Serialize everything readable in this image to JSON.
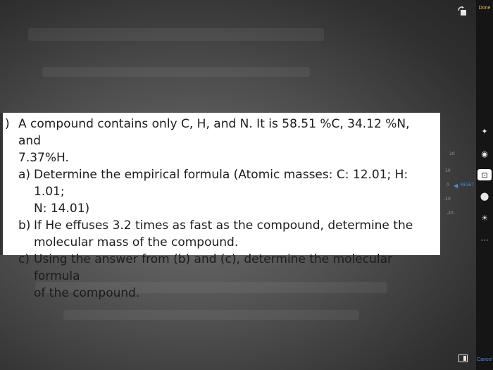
{
  "editor": {
    "done_label": "Done",
    "cancel_label": "Cancel",
    "dial_ticks": [
      "20",
      "10",
      "0",
      "-10",
      "-20"
    ],
    "dial_reset_label": "RESET",
    "tools": [
      "magic-wand-icon",
      "red-eye-icon",
      "crop-rotate-icon",
      "filters-icon",
      "adjust-light-icon",
      "more-icon"
    ],
    "accent_color": "#3d8ef0",
    "done_color": "#f2b92a"
  },
  "question": {
    "bracket": ")",
    "intro": "A compound contains only C, H, and N.  It is 58.51 %C, 34.12 %N, and",
    "intro_cont": "7.37%H.",
    "items": [
      {
        "letter": "a)",
        "line1": "Determine the empirical formula (Atomic masses: C: 12.01; H: 1.01;",
        "line2": "N: 14.01)"
      },
      {
        "letter": "b)",
        "line1": "If He effuses 3.2 times as fast as the compound, determine the",
        "line2": "molecular mass of the compound."
      },
      {
        "letter": "c)",
        "line1": "Using the answer from (b) and (c), determine the molecular formula",
        "line2": "of the compound."
      }
    ]
  }
}
